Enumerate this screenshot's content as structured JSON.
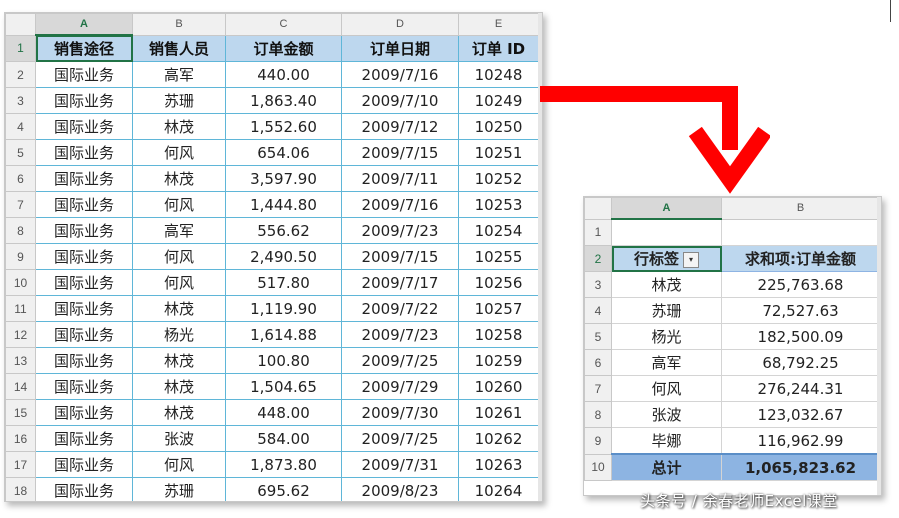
{
  "sheet1": {
    "column_headers": [
      "A",
      "B",
      "C",
      "D",
      "E"
    ],
    "row_headers": [
      "1",
      "2",
      "3",
      "4",
      "5",
      "6",
      "7",
      "8",
      "9",
      "10",
      "11",
      "12",
      "13",
      "14",
      "15",
      "16",
      "17",
      "18"
    ],
    "field_headers": [
      "销售途径",
      "销售人员",
      "订单金额",
      "订单日期",
      "订单 ID"
    ],
    "rows": [
      [
        "国际业务",
        "高军",
        "440.00",
        "2009/7/16",
        "10248"
      ],
      [
        "国际业务",
        "苏珊",
        "1,863.40",
        "2009/7/10",
        "10249"
      ],
      [
        "国际业务",
        "林茂",
        "1,552.60",
        "2009/7/12",
        "10250"
      ],
      [
        "国际业务",
        "何风",
        "654.06",
        "2009/7/15",
        "10251"
      ],
      [
        "国际业务",
        "林茂",
        "3,597.90",
        "2009/7/11",
        "10252"
      ],
      [
        "国际业务",
        "何风",
        "1,444.80",
        "2009/7/16",
        "10253"
      ],
      [
        "国际业务",
        "高军",
        "556.62",
        "2009/7/23",
        "10254"
      ],
      [
        "国际业务",
        "何风",
        "2,490.50",
        "2009/7/15",
        "10255"
      ],
      [
        "国际业务",
        "何风",
        "517.80",
        "2009/7/17",
        "10256"
      ],
      [
        "国际业务",
        "林茂",
        "1,119.90",
        "2009/7/22",
        "10257"
      ],
      [
        "国际业务",
        "杨光",
        "1,614.88",
        "2009/7/23",
        "10258"
      ],
      [
        "国际业务",
        "林茂",
        "100.80",
        "2009/7/25",
        "10259"
      ],
      [
        "国际业务",
        "林茂",
        "1,504.65",
        "2009/7/29",
        "10260"
      ],
      [
        "国际业务",
        "林茂",
        "448.00",
        "2009/7/30",
        "10261"
      ],
      [
        "国际业务",
        "张波",
        "584.00",
        "2009/7/25",
        "10262"
      ],
      [
        "国际业务",
        "何风",
        "1,873.80",
        "2009/7/31",
        "10263"
      ],
      [
        "国际业务",
        "苏珊",
        "695.62",
        "2009/8/23",
        "10264"
      ]
    ]
  },
  "sheet2": {
    "column_headers": [
      "A",
      "B"
    ],
    "row_headers": [
      "1",
      "2",
      "3",
      "4",
      "5",
      "6",
      "7",
      "8",
      "9",
      "10"
    ],
    "pivot_headers": [
      "行标签",
      "求和项:订单金额"
    ],
    "filter_icon": "▾",
    "rows": [
      [
        "林茂",
        "225,763.68"
      ],
      [
        "苏珊",
        "72,527.63"
      ],
      [
        "杨光",
        "182,500.09"
      ],
      [
        "高军",
        "68,792.25"
      ],
      [
        "何风",
        "276,244.31"
      ],
      [
        "张波",
        "123,032.67"
      ],
      [
        "毕娜",
        "116,962.99"
      ]
    ],
    "total": [
      "总计",
      "1,065,823.62"
    ]
  },
  "arrow_color": "#ff0000",
  "header_fill": "#bdd7ee",
  "total_fill": "#8db4e2",
  "watermark": "头条号 / 余春老师Excel课堂"
}
